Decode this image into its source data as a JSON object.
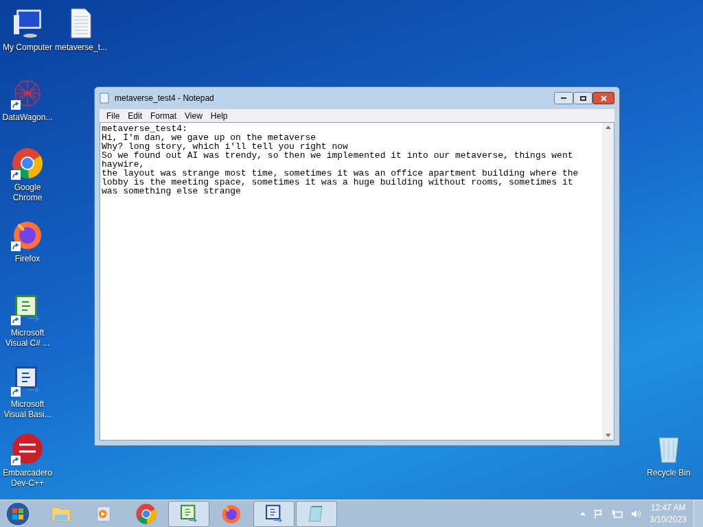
{
  "desktop_icons": [
    {
      "kind": "computer",
      "label": "My Computer",
      "shortcut": false
    },
    {
      "kind": "document",
      "label": "metaverse_t...",
      "shortcut": false
    },
    {
      "kind": "network",
      "label": "DataWagon...",
      "shortcut": true
    },
    {
      "kind": "chrome",
      "label": "Google Chrome",
      "shortcut": true
    },
    {
      "kind": "firefox",
      "label": "Firefox",
      "shortcut": true
    },
    {
      "kind": "csharp",
      "label": "Microsoft Visual C# ...",
      "shortcut": true
    },
    {
      "kind": "vb",
      "label": "Microsoft Visual Basi...",
      "shortcut": true
    },
    {
      "kind": "devcpp",
      "label": "Embarcadero Dev-C++",
      "shortcut": true
    },
    {
      "kind": "recycle",
      "label": "Recycle Bin",
      "shortcut": false
    }
  ],
  "window": {
    "title": "metaverse_test4 - Notepad",
    "menu": [
      "File",
      "Edit",
      "Format",
      "View",
      "Help"
    ],
    "lines": [
      "metaverse_test4:",
      "Hi, I'm dan, we gave up on the metaverse",
      "Why? long story, which i'll tell you right now",
      "So we found out AI was trendy, so then we implemented it into our metaverse, things went",
      "haywire,",
      "the layout was strange most time, sometimes it was an office apartment building where the",
      "lobby is the meeting space, sometimes it was a huge building without rooms, sometimes it",
      "was something else strange"
    ]
  },
  "taskbar": {
    "items": [
      {
        "kind": "explorer",
        "running": false
      },
      {
        "kind": "media",
        "running": false
      },
      {
        "kind": "chrome",
        "running": false
      },
      {
        "kind": "csharp",
        "running": true
      },
      {
        "kind": "firefox",
        "running": false
      },
      {
        "kind": "vb",
        "running": true
      },
      {
        "kind": "notepad",
        "running": true
      }
    ],
    "time": "12:47 AM",
    "date": "3/10/2023"
  }
}
